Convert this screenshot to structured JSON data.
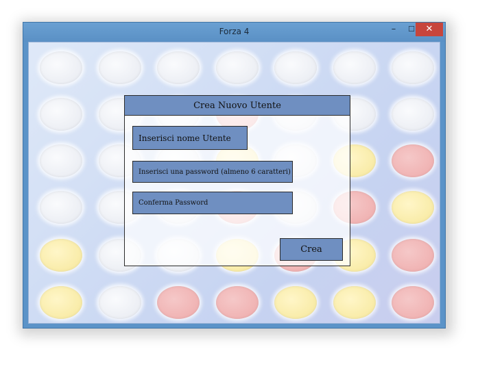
{
  "window": {
    "title": "Forza 4",
    "minimize_glyph": "–",
    "maximize_glyph": "☐",
    "close_glyph": "✕",
    "close_color": "#c7453c"
  },
  "board": {
    "rows": [
      [
        "white",
        "white",
        "white",
        "white",
        "white",
        "white",
        "white"
      ],
      [
        "white",
        "white",
        "white",
        "red",
        "white",
        "white",
        "white"
      ],
      [
        "white",
        "white",
        "white",
        "yellow",
        "white",
        "yellow",
        "red"
      ],
      [
        "white",
        "white",
        "white",
        "red",
        "white",
        "red",
        "yellow"
      ],
      [
        "yellow",
        "white",
        "white",
        "yellow",
        "red",
        "yellow",
        "red"
      ],
      [
        "yellow",
        "white",
        "red",
        "red",
        "yellow",
        "yellow",
        "red"
      ]
    ]
  },
  "dialog": {
    "title": "Crea Nuovo Utente",
    "username_placeholder": "Inserisci nome Utente",
    "password_placeholder": "Inserisci una password (almeno 6 caratteri)",
    "confirm_placeholder": "Conferma Password",
    "create_label": "Crea",
    "accent": "#6f8fc1"
  }
}
